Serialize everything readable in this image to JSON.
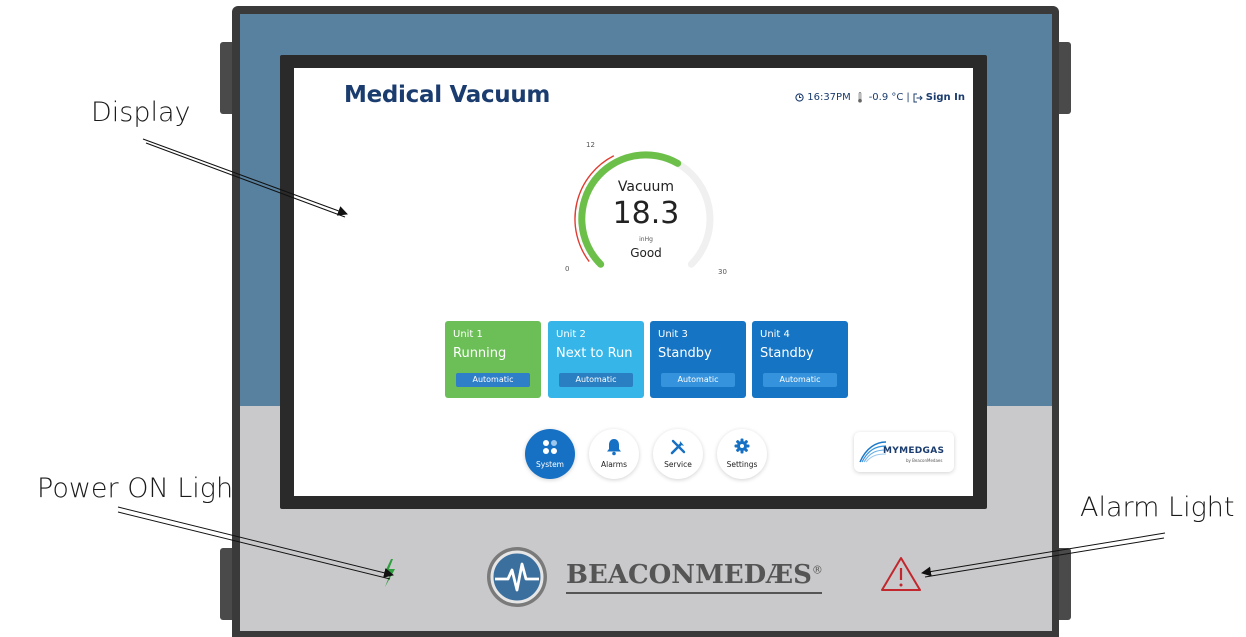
{
  "annotations": {
    "display": "Display",
    "power_light": "Power ON Light",
    "alarm_light": "Alarm Light"
  },
  "screen": {
    "title": "Medical Vacuum",
    "status": {
      "clock_icon": "clock-icon",
      "time": "16:37PM",
      "thermometer_icon": "thermometer-icon",
      "temperature": "-0.9 °C",
      "separator": "|",
      "sign_in_icon": "sign-in-icon",
      "sign_in": "Sign In"
    },
    "gauge": {
      "label": "Vacuum",
      "value": "18.3",
      "unit": "inHg",
      "status": "Good",
      "min_label": "0",
      "max_label": "30",
      "mark_label": "12",
      "value_fraction": 0.61,
      "colors": {
        "fill": "#6cc04a",
        "track": "#f0f0f0",
        "low_zone": "#e03c31"
      }
    },
    "units": [
      {
        "name": "Unit 1",
        "state": "Running",
        "mode": "Automatic",
        "color": "#6cbf57",
        "mode_color": "#2e7ec8"
      },
      {
        "name": "Unit 2",
        "state": "Next to Run",
        "mode": "Automatic",
        "color": "#36b6e8",
        "mode_color": "#2a7fc2"
      },
      {
        "name": "Unit 3",
        "state": "Standby",
        "mode": "Automatic",
        "color": "#1575c4",
        "mode_color": "#3592dc"
      },
      {
        "name": "Unit 4",
        "state": "Standby",
        "mode": "Automatic",
        "color": "#1575c4",
        "mode_color": "#3592dc"
      }
    ],
    "nav": [
      {
        "label": "System",
        "icon": "grid-icon",
        "active": true
      },
      {
        "label": "Alarms",
        "icon": "bell-icon",
        "active": false
      },
      {
        "label": "Service",
        "icon": "tools-icon",
        "active": false
      },
      {
        "label": "Settings",
        "icon": "gear-icon",
        "active": false
      }
    ],
    "partner_logo": {
      "name": "MYMEDGAS",
      "byline": "by BeaconMedaes"
    }
  },
  "device": {
    "brand": "BEACONMEDÆS",
    "brand_mark": "®",
    "power_icon": "lightning-icon",
    "alarm_icon": "warning-triangle-icon",
    "colors": {
      "housing_top": "#58819f",
      "housing_bottom": "#c9c9cb",
      "power": "#2e9e3e",
      "alarm": "#c2272d"
    }
  }
}
